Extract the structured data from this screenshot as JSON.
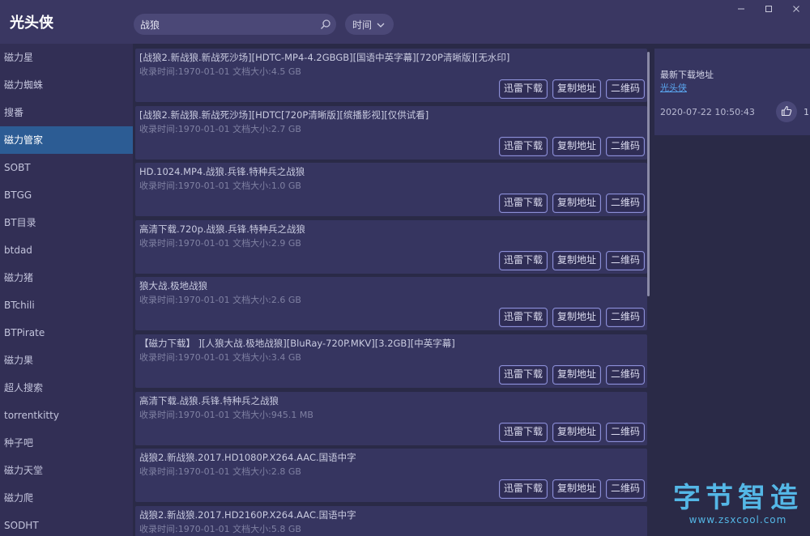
{
  "app": {
    "title": "光头侠"
  },
  "search": {
    "value": "战狼",
    "sort_label": "时间"
  },
  "sidebar": {
    "items": [
      {
        "label": "磁力星"
      },
      {
        "label": "磁力蜘蛛"
      },
      {
        "label": "搜番"
      },
      {
        "label": "磁力管家",
        "active": true
      },
      {
        "label": "SOBT"
      },
      {
        "label": "BTGG"
      },
      {
        "label": "BT目录"
      },
      {
        "label": "btdad"
      },
      {
        "label": "磁力猪"
      },
      {
        "label": "BTchili"
      },
      {
        "label": "BTPirate"
      },
      {
        "label": "磁力果"
      },
      {
        "label": "超人搜索"
      },
      {
        "label": "torrentkitty"
      },
      {
        "label": "种子吧"
      },
      {
        "label": "磁力天堂"
      },
      {
        "label": "磁力爬"
      },
      {
        "label": "SODHT"
      }
    ]
  },
  "buttons": {
    "thunder": "迅雷下载",
    "copy": "复制地址",
    "qrcode": "二维码"
  },
  "results": [
    {
      "title": "[战狼2.新战狼.新战死沙场][HDTC-MP4-4.2GBGB][国语中英字幕][720P清晰版][无水印]",
      "meta": "收录时间:1970-01-01 文档大小:4.5 GB"
    },
    {
      "title": "[战狼2.新战狼.新战死沙场][HDTC[720P清晰版][缤播影视][仅供试看]",
      "meta": "收录时间:1970-01-01 文档大小:2.7 GB"
    },
    {
      "title": "HD.1024.MP4.战狼.兵锋.特种兵之战狼",
      "meta": "收录时间:1970-01-01 文档大小:1.0 GB"
    },
    {
      "title": "高清下载.720p.战狼.兵锋.特种兵之战狼",
      "meta": "收录时间:1970-01-01 文档大小:2.9 GB"
    },
    {
      "title": "狼大战.极地战狼",
      "meta": "收录时间:1970-01-01 文档大小:2.6 GB"
    },
    {
      "title": "【磁力下载】 ][人狼大战.极地战狼][BluRay-720P.MKV][3.2GB][中英字幕]",
      "meta": "收录时间:1970-01-01 文档大小:3.4 GB"
    },
    {
      "title": "高清下载.战狼.兵锋.特种兵之战狼",
      "meta": "收录时间:1970-01-01 文档大小:945.1 MB"
    },
    {
      "title": "战狼2.新战狼.2017.HD1080P.X264.AAC.国语中字",
      "meta": "收录时间:1970-01-01 文档大小:2.8 GB"
    },
    {
      "title": "战狼2.新战狼.2017.HD2160P.X264.AAC.国语中字",
      "meta": "收录时间:1970-01-01 文档大小:5.8 GB"
    }
  ],
  "panel": {
    "label": "最新下载地址",
    "link": "光头侠",
    "date": "2020-07-22 10:50:43",
    "likes": "1"
  },
  "watermark": {
    "text": "字节智造",
    "url": "www.zsxcool.com"
  },
  "colors": {
    "accent": "#2c5c94",
    "link": "#5aa7f0",
    "watermark": "#54b7e6"
  }
}
